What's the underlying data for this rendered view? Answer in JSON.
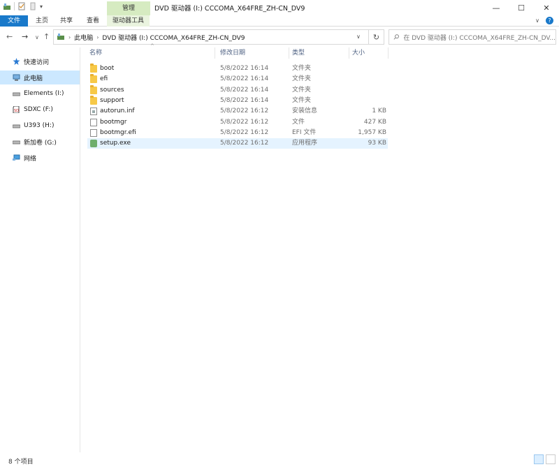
{
  "window": {
    "title": "DVD 驱动器 (I:) CCCOMA_X64FRE_ZH-CN_DV9",
    "context_tab_group": "管理",
    "controls": {
      "minimize": "—",
      "maximize": "☐",
      "close": "✕"
    }
  },
  "ribbon": {
    "tabs": [
      {
        "label": "文件"
      },
      {
        "label": "主页"
      },
      {
        "label": "共享"
      },
      {
        "label": "查看"
      },
      {
        "label": "驱动器工具"
      }
    ],
    "toggle_label": "∨",
    "help_label": "?"
  },
  "navigation": {
    "back": "←",
    "forward": "→",
    "recent": "∨",
    "up": "↑",
    "breadcrumb": [
      {
        "label": "此电脑"
      },
      {
        "label": "DVD 驱动器 (I:) CCCOMA_X64FRE_ZH-CN_DV9"
      }
    ],
    "dropdown": "∨",
    "refresh": "↻",
    "search_placeholder": "在 DVD 驱动器 (I:) CCCOMA_X64FRE_ZH-CN_DV..."
  },
  "sidebar": {
    "items": [
      {
        "label": "快速访问",
        "icon": "star-icon"
      },
      {
        "label": "此电脑",
        "icon": "computer-icon",
        "selected": true
      },
      {
        "label": "Elements (I:)",
        "icon": "drive-icon"
      },
      {
        "label": "SDXC (F:)",
        "icon": "sd-card-icon"
      },
      {
        "label": "U393 (H:)",
        "icon": "drive-icon"
      },
      {
        "label": "新加卷 (G:)",
        "icon": "drive-icon"
      },
      {
        "label": "网络",
        "icon": "network-icon"
      }
    ]
  },
  "filelist": {
    "columns": {
      "name": "名称",
      "date": "修改日期",
      "type": "类型",
      "size": "大小"
    },
    "rows": [
      {
        "name": "boot",
        "date": "5/8/2022 16:14",
        "type": "文件夹",
        "size": "",
        "icon": "folder-icon"
      },
      {
        "name": "efi",
        "date": "5/8/2022 16:14",
        "type": "文件夹",
        "size": "",
        "icon": "folder-icon"
      },
      {
        "name": "sources",
        "date": "5/8/2022 16:14",
        "type": "文件夹",
        "size": "",
        "icon": "folder-icon"
      },
      {
        "name": "support",
        "date": "5/8/2022 16:14",
        "type": "文件夹",
        "size": "",
        "icon": "folder-icon"
      },
      {
        "name": "autorun.inf",
        "date": "5/8/2022 16:12",
        "type": "安装信息",
        "size": "1 KB",
        "icon": "setup-info-icon"
      },
      {
        "name": "bootmgr",
        "date": "5/8/2022 16:12",
        "type": "文件",
        "size": "427 KB",
        "icon": "file-icon"
      },
      {
        "name": "bootmgr.efi",
        "date": "5/8/2022 16:12",
        "type": "EFI 文件",
        "size": "1,957 KB",
        "icon": "file-icon"
      },
      {
        "name": "setup.exe",
        "date": "5/8/2022 16:12",
        "type": "应用程序",
        "size": "93 KB",
        "icon": "setup-exe-icon",
        "highlighted": true
      }
    ]
  },
  "status": {
    "item_count": "8 个项目"
  },
  "colors": {
    "file_tab": "#1979ca",
    "context_tab": "#d6ebc1",
    "selection": "#cce8ff",
    "hover_row": "#e5f3ff",
    "folder": "#f7c948"
  }
}
